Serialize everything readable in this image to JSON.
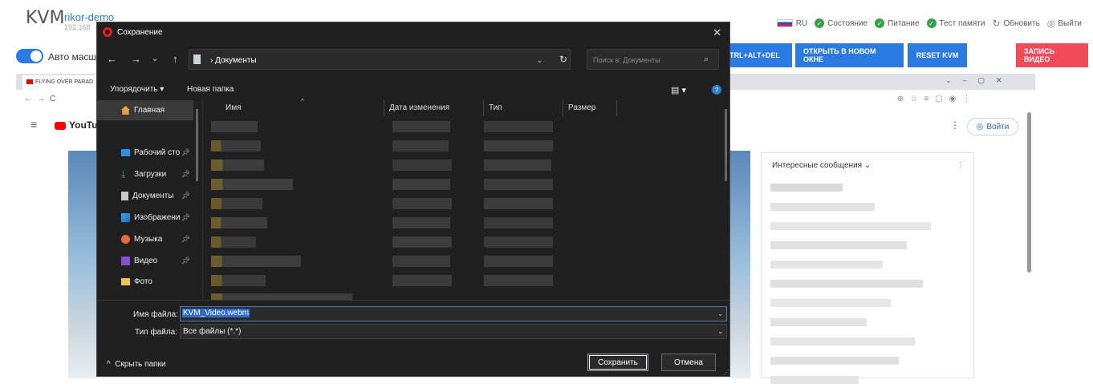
{
  "kvm": {
    "title": "KVM",
    "host": "rikor-demo",
    "ip": "192.168",
    "status": [
      {
        "label": "RU"
      },
      {
        "label": "Состояние"
      },
      {
        "label": "Питание"
      },
      {
        "label": "Тест памяти"
      },
      {
        "label": "Обновить"
      },
      {
        "label": "Выйти"
      }
    ],
    "auto_scale_label": "Авто масш",
    "buttons": {
      "ctrl_alt_del": "TRL+ALT+DEL",
      "open_new_window": "ОТКРЫТЬ В НОВОМ ОКНЕ",
      "reset": "RESET KVM",
      "record": "ЗАПИСЬ ВИДЕО"
    },
    "colors": {
      "accent": "#2a7ae2",
      "record": "#f14b5a",
      "ok": "#35a14a"
    }
  },
  "remote_browser": {
    "tab_title": "FLYING OVER PARAD",
    "youtube_logo": "YouTub",
    "signin": "Войти",
    "chat_title": "Интересные сообщения"
  },
  "dialog": {
    "title": "Сохранение",
    "path": "Документы",
    "search_placeholder": "Поиск в: Документы",
    "organize": "Упорядочить",
    "new_folder": "Новая папка",
    "sidebar": [
      {
        "label": "Главная",
        "icon": "home-icon",
        "pinned": false
      },
      {
        "label": "Рабочий сто",
        "icon": "desktop-icon",
        "pinned": true
      },
      {
        "label": "Загрузки",
        "icon": "download-icon",
        "pinned": true
      },
      {
        "label": "Документы",
        "icon": "documents-icon",
        "pinned": true
      },
      {
        "label": "Изображени",
        "icon": "pictures-icon",
        "pinned": true
      },
      {
        "label": "Музыка",
        "icon": "music-icon",
        "pinned": true
      },
      {
        "label": "Видео",
        "icon": "video-icon",
        "pinned": true
      },
      {
        "label": "Фото",
        "icon": "folder-icon",
        "pinned": false
      }
    ],
    "columns": {
      "name": "Имя",
      "modified": "Дата изменения",
      "type": "Тип",
      "size": "Размер"
    },
    "file_name_label": "Имя файла:",
    "file_name": "KVM_Video.webm",
    "file_type_label": "Тип файла:",
    "file_type": "Все файлы (*.*)",
    "hide_folders": "Скрыть папки",
    "save": "Сохранить",
    "cancel": "Отмена"
  }
}
